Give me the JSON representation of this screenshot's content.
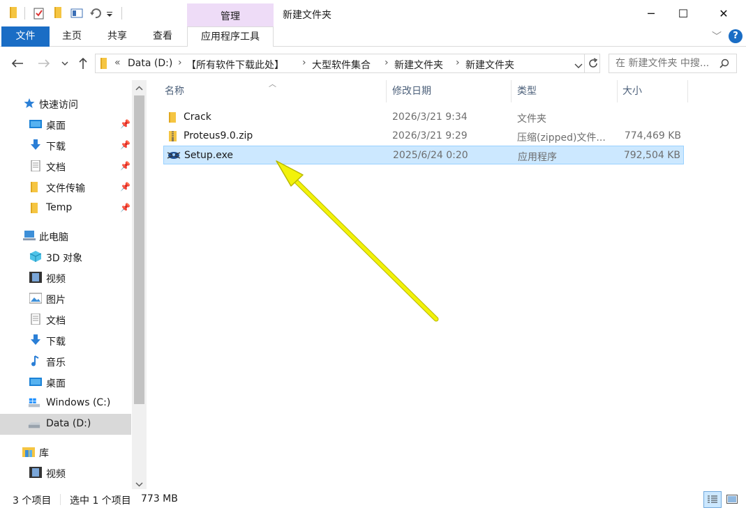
{
  "window": {
    "title": "新建文件夹",
    "context_tab_group": "管理",
    "controls": {
      "minimize": "─",
      "maximize": "☐",
      "close": "✕"
    }
  },
  "quick_access_toolbar": {
    "items": [
      "folder-icon",
      "properties-icon",
      "new-folder-icon",
      "rename-icon",
      "undo-icon",
      "customize-dropdown-icon"
    ]
  },
  "ribbon": {
    "tabs": [
      {
        "label": "文件"
      },
      {
        "label": "主页"
      },
      {
        "label": "共享"
      },
      {
        "label": "查看"
      },
      {
        "label": "应用程序工具"
      }
    ],
    "expand_symbol": "﹀",
    "help_symbol": "?"
  },
  "address": {
    "overflow": "«",
    "crumbs": [
      "Data (D:)",
      "【所有软件下载此处】",
      "大型软件集合",
      "新建文件夹",
      "新建文件夹"
    ],
    "separator": "›"
  },
  "search": {
    "placeholder": "在 新建文件夹 中搜..."
  },
  "sidebar": {
    "quick_access": {
      "label": "快速访问",
      "items": [
        {
          "label": "桌面",
          "icon": "desktop-icon",
          "pinned": true
        },
        {
          "label": "下载",
          "icon": "download-icon",
          "pinned": true
        },
        {
          "label": "文档",
          "icon": "document-icon",
          "pinned": true
        },
        {
          "label": "文件传输",
          "icon": "folder-icon",
          "pinned": true
        },
        {
          "label": "Temp",
          "icon": "folder-icon",
          "pinned": true
        }
      ]
    },
    "this_pc": {
      "label": "此电脑",
      "items": [
        {
          "label": "3D 对象",
          "icon": "3d-objects-icon"
        },
        {
          "label": "视频",
          "icon": "video-icon"
        },
        {
          "label": "图片",
          "icon": "pictures-icon"
        },
        {
          "label": "文档",
          "icon": "document-icon"
        },
        {
          "label": "下载",
          "icon": "download-icon"
        },
        {
          "label": "音乐",
          "icon": "music-icon"
        },
        {
          "label": "桌面",
          "icon": "desktop-icon"
        },
        {
          "label": "Windows (C:)",
          "icon": "windows-drive-icon"
        },
        {
          "label": "Data (D:)",
          "icon": "drive-icon",
          "selected": true
        }
      ]
    },
    "libraries": {
      "label": "库",
      "items": [
        {
          "label": "视频",
          "icon": "video-icon"
        }
      ]
    }
  },
  "columns": {
    "name": "名称",
    "modified": "修改日期",
    "type": "类型",
    "size": "大小"
  },
  "files": [
    {
      "name": "Crack",
      "modified": "2026/3/21 9:34",
      "type": "文件夹",
      "size": "",
      "icon": "folder-icon"
    },
    {
      "name": "Proteus9.0.zip",
      "modified": "2026/3/21 9:29",
      "type": "压缩(zipped)文件...",
      "size": "774,469 KB",
      "icon": "zip-folder-icon"
    },
    {
      "name": "Setup.exe",
      "modified": "2025/6/24 0:20",
      "type": "应用程序",
      "size": "792,504 KB",
      "icon": "setup-exe-icon",
      "selected": true
    }
  ],
  "annotation": {
    "color": "#f2f20a",
    "points_to": "Setup.exe"
  },
  "status": {
    "item_count": "3 个项目",
    "selection": "选中 1 个项目",
    "selection_size": "773 MB"
  },
  "colors": {
    "accent": "#1a6dc5",
    "context_tab": "#eedcf7",
    "selection": "#cce8ff",
    "selection_border": "#99d1ff",
    "header_text": "#4c607a"
  }
}
